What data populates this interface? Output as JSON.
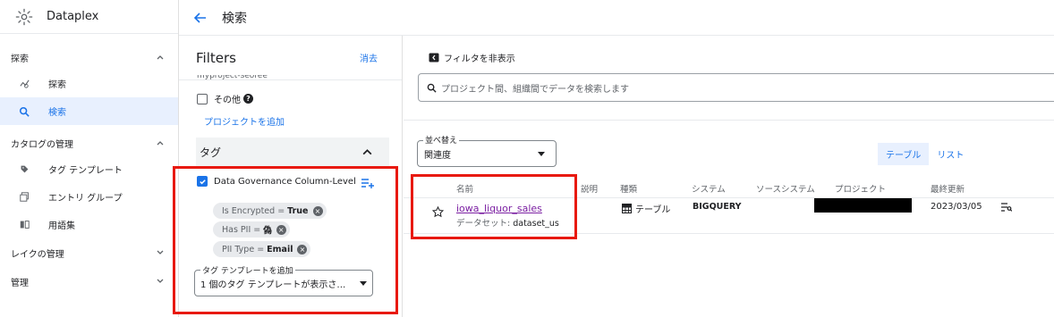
{
  "app": {
    "name": "Dataplex"
  },
  "header": {
    "title": "検索",
    "back_icon": "arrow-back-icon"
  },
  "sidebar": {
    "sections": [
      {
        "label": "探索",
        "expanded": true
      },
      {
        "label": "カタログの管理",
        "expanded": true
      },
      {
        "label": "レイクの管理",
        "expanded": false
      },
      {
        "label": "管理",
        "expanded": false
      }
    ],
    "items": [
      {
        "label": "探索",
        "icon": "explore-icon",
        "active": false
      },
      {
        "label": "検索",
        "icon": "search-icon",
        "active": true
      },
      {
        "label": "タグ テンプレート",
        "icon": "tag-icon",
        "active": false
      },
      {
        "label": "エントリ グループ",
        "icon": "entry-group-icon",
        "active": false
      },
      {
        "label": "用語集",
        "icon": "glossary-icon",
        "active": false
      }
    ]
  },
  "filters": {
    "title": "Filters",
    "clear_label": "消去",
    "truncated_item": "myproject-seoree",
    "other_label": "その他",
    "add_project_label": "プロジェクトを追加",
    "tag_section_label": "タグ",
    "tag_name": "Data Governance Column-Level",
    "chips": [
      {
        "key": "Is Encrypted",
        "value": "True"
      },
      {
        "key": "Has PII",
        "value": "偽"
      },
      {
        "key": "PII Type",
        "value": "Email"
      }
    ],
    "template_select": {
      "label": "タグ テンプレートを追加",
      "value": "1 個のタグ テンプレートが表示さ…"
    }
  },
  "main": {
    "hide_filters_label": "フィルタを非表示",
    "search_placeholder": "プロジェクト間、組織間でデータを検索します",
    "sort": {
      "label": "並べ替え",
      "value": "関連度"
    },
    "views": [
      "テーブル",
      "リスト"
    ],
    "columns": [
      "名前",
      "説明",
      "種類",
      "システム",
      "ソースシステム",
      "プロジェクト",
      "最終更新"
    ],
    "rows": [
      {
        "name": "iowa_liquor_sales",
        "dataset_label": "データセット:",
        "dataset": "dataset_us",
        "type": "テーブル",
        "system": "BIGQUERY",
        "updated": "2023/03/05"
      }
    ]
  },
  "colors": {
    "accent": "#1a73e8",
    "highlight": "#e8190f",
    "link": "#7b1fa2"
  }
}
